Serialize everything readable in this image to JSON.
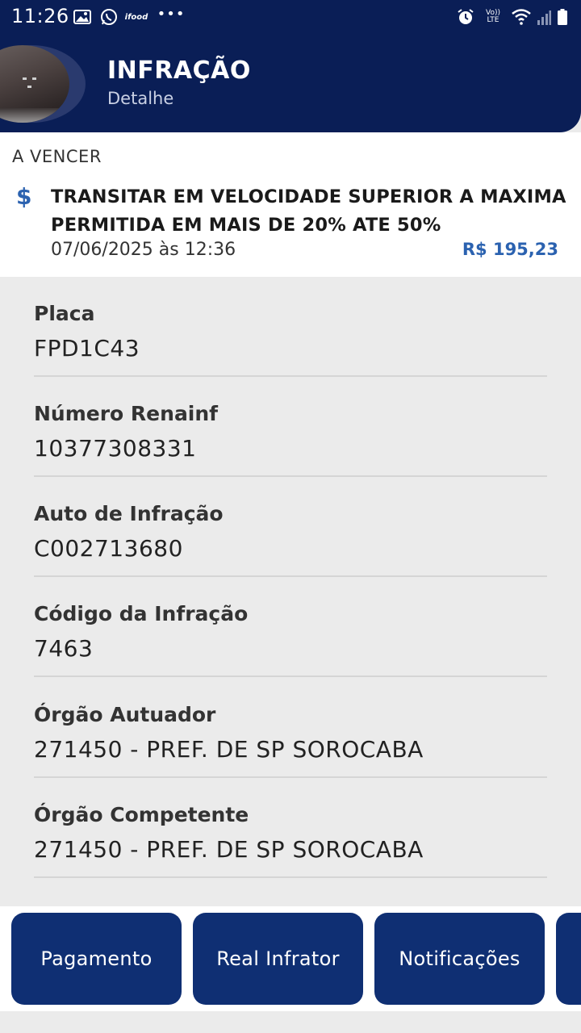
{
  "status_bar": {
    "time": "11:26",
    "ifood_label": "ifood",
    "dots": "•••",
    "volte_top": "Vo))",
    "volte_bottom": "LTE",
    "icons": [
      "gallery-icon",
      "whatsapp-icon",
      "ifood-icon",
      "more-icon",
      "alarm-icon",
      "volte-icon",
      "wifi-icon",
      "signal-icon",
      "battery-icon"
    ]
  },
  "header": {
    "title": "INFRAÇÃO",
    "subtitle": "Detalhe"
  },
  "summary": {
    "status": "A VENCER",
    "icon": "$",
    "description": "TRANSITAR EM VELOCIDADE SUPERIOR A MAXIMA PERMITIDA EM MAIS DE 20% ATE 50%",
    "date": "07/06/2025 às 12:36",
    "value": "R$ 195,23"
  },
  "details": [
    {
      "label": "Placa",
      "value": "FPD1C43"
    },
    {
      "label": "Número Renainf",
      "value": "10377308331"
    },
    {
      "label": "Auto de Infração",
      "value": "C002713680"
    },
    {
      "label": "Código da Infração",
      "value": "7463"
    },
    {
      "label": "Órgão Autuador",
      "value": "271450 - PREF. DE SP SOROCABA"
    },
    {
      "label": "Órgão Competente",
      "value": "271450 - PREF. DE SP SOROCABA"
    }
  ],
  "actions": [
    {
      "label": "Pagamento"
    },
    {
      "label": "Real Infrator"
    },
    {
      "label": "Notificações"
    },
    {
      "label": ""
    }
  ],
  "colors": {
    "primary": "#0a1e56",
    "button": "#0f2f73",
    "accent": "#2b62b0",
    "background": "#ebebeb"
  }
}
